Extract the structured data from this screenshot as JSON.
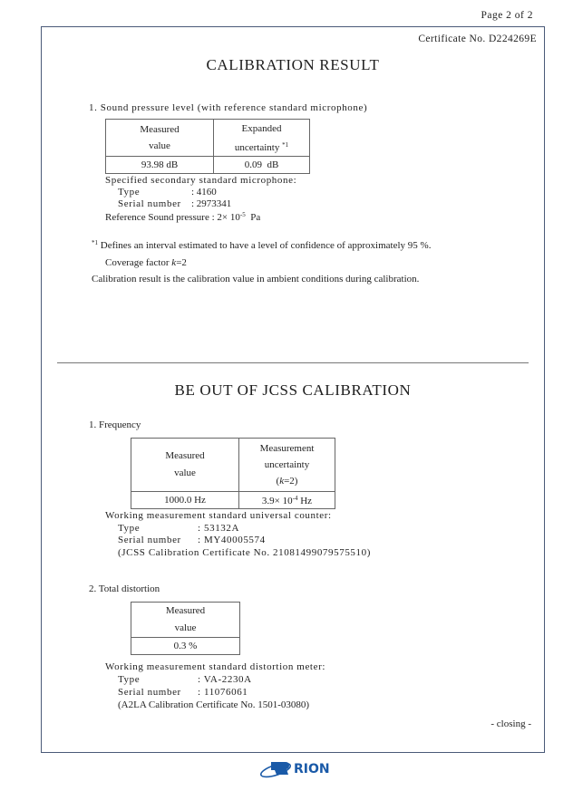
{
  "header": {
    "page_label": "Page 2 of 2",
    "certificate_no": "Certificate No. D224269E"
  },
  "calibration_result": {
    "title": "CALIBRATION RESULT",
    "section1": {
      "heading": "1. Sound pressure level (with reference standard microphone)",
      "table": {
        "headers": [
          [
            "Measured",
            "value"
          ],
          [
            "Expanded",
            "uncertainty"
          ]
        ],
        "footnote_mark": "*1",
        "row": [
          "93.98 dB",
          "0.09  dB"
        ]
      },
      "microphone_label": "Specified secondary standard microphone:",
      "type_label": "Type",
      "type_value": ": 4160",
      "serial_label": "Serial number",
      "serial_value": ": 2973341",
      "reference_pressure_label": "Reference Sound pressure",
      "reference_pressure_value": ": 2× 10",
      "reference_pressure_exp": "-5",
      "reference_pressure_unit": "Pa"
    },
    "footnote": {
      "mark": "*1",
      "text": "Defines an interval estimated to have a level of confidence of approximately 95 %.",
      "coverage_prefix": "Coverage factor ",
      "coverage_k": "k",
      "coverage_value": "=2"
    },
    "note": "Calibration result is the calibration value in ambient conditions during calibration."
  },
  "out_of_jcss": {
    "title": "BE OUT OF JCSS CALIBRATION",
    "frequency": {
      "heading": "1. Frequency",
      "table": {
        "header_measured": [
          "Measured",
          "value"
        ],
        "header_uncertainty": [
          "Measurement",
          "uncertainty",
          "(",
          "k",
          "=2)"
        ],
        "row_value": "1000.0 Hz",
        "row_uncertainty_base": "3.9× 10",
        "row_uncertainty_exp": "-4",
        "row_uncertainty_unit": " Hz"
      },
      "standard_label": "Working measurement standard universal counter:",
      "type_label": "Type",
      "type_value": ": 53132A",
      "serial_label": "Serial number",
      "serial_value": ": MY40005574",
      "certificate": "(JCSS Calibration Certificate No. 21081499079575510)"
    },
    "distortion": {
      "heading": "2. Total distortion",
      "table": {
        "header": [
          "Measured",
          "value"
        ],
        "row": "0.3 %"
      },
      "standard_label": "Working measurement standard distortion meter:",
      "type_label": "Type",
      "type_value": ": VA-2230A",
      "serial_label": "Serial number",
      "serial_value": ": 11076061",
      "certificate": "(A2LA Calibration Certificate No. 1501-03080)"
    },
    "closing": "- closing -"
  },
  "footer": {
    "logo_text": "RION",
    "logo_color": "#1a5aa8"
  }
}
